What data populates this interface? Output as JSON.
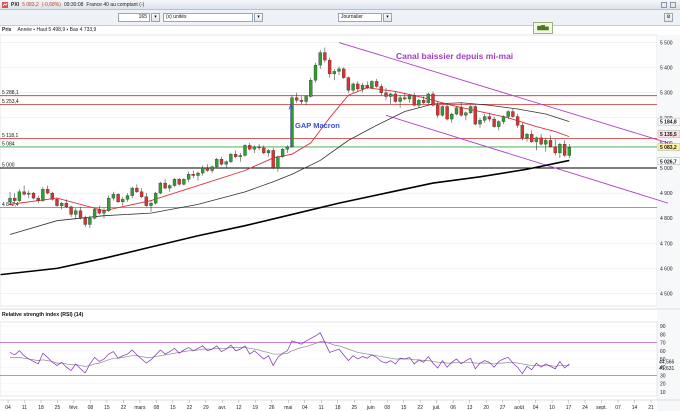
{
  "window": {
    "symbol": "PXI",
    "price": "5 083,2",
    "change": "(-0,68%)",
    "time": "09:30:08",
    "instrument": "France 40 au comptant (-)"
  },
  "toolbar": {
    "count_value": "165",
    "units_label": "(x) unités",
    "period_label": "Journalier"
  },
  "chart_head": {
    "symbol": "Prix",
    "info": "Année ▪ Haut 5 498,9 ▪ Bas 4 733,9"
  },
  "chart_data": {
    "type": "line",
    "subtype": "candlestick",
    "annotations": {
      "channel_title": "Canal baissier depuis mi-mai",
      "gap_label": "GAP Macron"
    },
    "price_axis": {
      "ticks": [
        5500,
        5400,
        5300,
        5200,
        5100,
        5000,
        4900,
        4800,
        4700,
        4600,
        4500
      ],
      "tick_labels": [
        "5 500",
        "5 400",
        "5 300",
        "5 200",
        "5 100",
        "5 000",
        "4 900",
        "4 800",
        "4 700",
        "4 600",
        "4 500"
      ],
      "ylim": [
        4450,
        5530
      ],
      "right_tags": [
        {
          "value": 5184.8,
          "label": "5 184,8",
          "color": "#ffffff"
        },
        {
          "value": 5135.5,
          "label": "5 135,5",
          "color": "#fde2e2"
        },
        {
          "value": 5083.2,
          "label": "5 083,2",
          "color": "#fff3a8"
        },
        {
          "value": 5026.7,
          "label": "5 026,7",
          "color": "#ffffff"
        }
      ]
    },
    "horizontal_levels": [
      {
        "value": 5288.1,
        "label": "5 288,1",
        "color": "#d42a2a"
      },
      {
        "value": 5253.4,
        "label": "5 253,4",
        "color": "#d42a2a"
      },
      {
        "value": 5118.1,
        "label": "5 118,1",
        "color": "#d42a2a"
      },
      {
        "value": 5084,
        "label": "5 084",
        "color": "#3aa63a"
      },
      {
        "value": 5000,
        "label": "5 000",
        "color": "#000000"
      },
      {
        "value": 4842.4,
        "label": "4 842,4",
        "color": "#3aa63a"
      }
    ],
    "x_axis": {
      "tick_labels": [
        "04",
        "11",
        "18",
        "25",
        "févr.",
        "08",
        "15",
        "22",
        "mars",
        "08",
        "15",
        "22",
        "29",
        "avr.",
        "12",
        "19",
        "26",
        "mai",
        "04",
        "11",
        "18",
        "25",
        "juin",
        "08",
        "15",
        "22",
        "juil.",
        "06",
        "13",
        "20",
        "27",
        "août",
        "04",
        "10",
        "17",
        "24",
        "sept.",
        "07",
        "14",
        "21"
      ]
    },
    "candles_ohlc": [
      [
        4865,
        4905,
        4855,
        4880
      ],
      [
        4880,
        4900,
        4860,
        4870
      ],
      [
        4870,
        4915,
        4865,
        4905
      ],
      [
        4905,
        4930,
        4890,
        4895
      ],
      [
        4895,
        4910,
        4880,
        4900
      ],
      [
        4900,
        4905,
        4875,
        4880
      ],
      [
        4880,
        4890,
        4860,
        4870
      ],
      [
        4870,
        4925,
        4865,
        4915
      ],
      [
        4915,
        4930,
        4895,
        4900
      ],
      [
        4900,
        4905,
        4870,
        4875
      ],
      [
        4875,
        4880,
        4845,
        4850
      ],
      [
        4850,
        4865,
        4835,
        4860
      ],
      [
        4860,
        4875,
        4840,
        4845
      ],
      [
        4845,
        4850,
        4805,
        4815
      ],
      [
        4815,
        4840,
        4795,
        4830
      ],
      [
        4830,
        4845,
        4795,
        4800
      ],
      [
        4800,
        4810,
        4765,
        4775
      ],
      [
        4775,
        4810,
        4760,
        4800
      ],
      [
        4800,
        4840,
        4795,
        4835
      ],
      [
        4835,
        4850,
        4815,
        4820
      ],
      [
        4820,
        4840,
        4800,
        4830
      ],
      [
        4830,
        4890,
        4825,
        4880
      ],
      [
        4880,
        4905,
        4870,
        4895
      ],
      [
        4895,
        4900,
        4860,
        4865
      ],
      [
        4865,
        4885,
        4850,
        4875
      ],
      [
        4875,
        4900,
        4865,
        4890
      ],
      [
        4890,
        4925,
        4880,
        4920
      ],
      [
        4920,
        4935,
        4900,
        4905
      ],
      [
        4905,
        4920,
        4880,
        4885
      ],
      [
        4885,
        4900,
        4845,
        4850
      ],
      [
        4850,
        4870,
        4825,
        4860
      ],
      [
        4860,
        4905,
        4855,
        4900
      ],
      [
        4900,
        4945,
        4895,
        4940
      ],
      [
        4940,
        4955,
        4915,
        4920
      ],
      [
        4920,
        4935,
        4905,
        4930
      ],
      [
        4930,
        4960,
        4925,
        4955
      ],
      [
        4955,
        4960,
        4930,
        4935
      ],
      [
        4935,
        4960,
        4930,
        4955
      ],
      [
        4955,
        4985,
        4945,
        4975
      ],
      [
        4975,
        4990,
        4960,
        4970
      ],
      [
        4970,
        4985,
        4950,
        4980
      ],
      [
        4980,
        5010,
        4970,
        5000
      ],
      [
        5000,
        5015,
        4985,
        4990
      ],
      [
        4990,
        5010,
        4980,
        5005
      ],
      [
        5005,
        5040,
        5000,
        5035
      ],
      [
        5035,
        5045,
        5010,
        5015
      ],
      [
        5015,
        5030,
        5000,
        5025
      ],
      [
        5025,
        5060,
        5020,
        5055
      ],
      [
        5055,
        5070,
        5040,
        5045
      ],
      [
        5045,
        5060,
        5025,
        5050
      ],
      [
        5050,
        5095,
        5045,
        5090
      ],
      [
        5090,
        5100,
        5070,
        5075
      ],
      [
        5075,
        5090,
        5060,
        5085
      ],
      [
        5085,
        5095,
        5070,
        5080
      ],
      [
        5080,
        5090,
        5055,
        5060
      ],
      [
        5060,
        5075,
        5045,
        5070
      ],
      [
        5070,
        5080,
        4995,
        5000
      ],
      [
        5000,
        5050,
        4985,
        5045
      ],
      [
        5045,
        5080,
        5040,
        5075
      ],
      [
        5075,
        5090,
        5060,
        5085
      ],
      [
        5085,
        5290,
        5085,
        5280
      ],
      [
        5280,
        5300,
        5260,
        5270
      ],
      [
        5270,
        5285,
        5255,
        5265
      ],
      [
        5265,
        5290,
        5250,
        5285
      ],
      [
        5285,
        5360,
        5280,
        5350
      ],
      [
        5350,
        5420,
        5340,
        5410
      ],
      [
        5410,
        5470,
        5395,
        5460
      ],
      [
        5460,
        5480,
        5420,
        5430
      ],
      [
        5430,
        5440,
        5360,
        5375
      ],
      [
        5375,
        5395,
        5350,
        5385
      ],
      [
        5385,
        5405,
        5370,
        5395
      ],
      [
        5395,
        5400,
        5355,
        5360
      ],
      [
        5360,
        5365,
        5300,
        5310
      ],
      [
        5310,
        5340,
        5300,
        5335
      ],
      [
        5335,
        5345,
        5305,
        5315
      ],
      [
        5315,
        5340,
        5300,
        5330
      ],
      [
        5330,
        5345,
        5315,
        5320
      ],
      [
        5320,
        5350,
        5315,
        5345
      ],
      [
        5345,
        5355,
        5320,
        5325
      ],
      [
        5325,
        5335,
        5290,
        5300
      ],
      [
        5300,
        5320,
        5270,
        5285
      ],
      [
        5285,
        5300,
        5255,
        5295
      ],
      [
        5295,
        5305,
        5260,
        5265
      ],
      [
        5265,
        5290,
        5240,
        5280
      ],
      [
        5280,
        5300,
        5270,
        5275
      ],
      [
        5275,
        5295,
        5260,
        5290
      ],
      [
        5290,
        5300,
        5245,
        5250
      ],
      [
        5250,
        5275,
        5240,
        5270
      ],
      [
        5270,
        5285,
        5255,
        5260
      ],
      [
        5260,
        5300,
        5255,
        5295
      ],
      [
        5295,
        5305,
        5245,
        5250
      ],
      [
        5250,
        5265,
        5200,
        5210
      ],
      [
        5210,
        5250,
        5205,
        5245
      ],
      [
        5245,
        5255,
        5190,
        5195
      ],
      [
        5195,
        5220,
        5180,
        5215
      ],
      [
        5215,
        5245,
        5210,
        5240
      ],
      [
        5240,
        5260,
        5205,
        5210
      ],
      [
        5210,
        5225,
        5190,
        5220
      ],
      [
        5220,
        5250,
        5215,
        5245
      ],
      [
        5245,
        5250,
        5170,
        5175
      ],
      [
        5175,
        5200,
        5160,
        5190
      ],
      [
        5190,
        5215,
        5180,
        5205
      ],
      [
        5205,
        5220,
        5185,
        5195
      ],
      [
        5195,
        5205,
        5160,
        5165
      ],
      [
        5165,
        5190,
        5150,
        5185
      ],
      [
        5185,
        5210,
        5175,
        5205
      ],
      [
        5205,
        5230,
        5195,
        5225
      ],
      [
        5225,
        5235,
        5200,
        5205
      ],
      [
        5205,
        5215,
        5160,
        5170
      ],
      [
        5170,
        5180,
        5110,
        5120
      ],
      [
        5120,
        5140,
        5105,
        5135
      ],
      [
        5135,
        5150,
        5100,
        5105
      ],
      [
        5105,
        5125,
        5070,
        5120
      ],
      [
        5120,
        5135,
        5090,
        5095
      ],
      [
        5095,
        5120,
        5065,
        5110
      ],
      [
        5110,
        5130,
        5080,
        5085
      ],
      [
        5085,
        5115,
        5050,
        5060
      ],
      [
        5060,
        5100,
        5040,
        5095
      ],
      [
        5095,
        5110,
        5045,
        5050
      ],
      [
        5050,
        5095,
        5040,
        5083
      ]
    ],
    "sma_short": [
      [
        0,
        4855
      ],
      [
        10,
        4880
      ],
      [
        20,
        4830
      ],
      [
        30,
        4870
      ],
      [
        40,
        4930
      ],
      [
        50,
        4990
      ],
      [
        56,
        5040
      ],
      [
        60,
        5055
      ],
      [
        64,
        5100
      ],
      [
        68,
        5200
      ],
      [
        72,
        5290
      ],
      [
        76,
        5320
      ],
      [
        82,
        5305
      ],
      [
        88,
        5280
      ],
      [
        94,
        5250
      ],
      [
        100,
        5225
      ],
      [
        106,
        5200
      ],
      [
        112,
        5165
      ],
      [
        116,
        5145
      ],
      [
        119,
        5125
      ]
    ],
    "sma_long": [
      [
        0,
        4735
      ],
      [
        10,
        4790
      ],
      [
        20,
        4810
      ],
      [
        30,
        4820
      ],
      [
        40,
        4855
      ],
      [
        50,
        4905
      ],
      [
        56,
        4945
      ],
      [
        60,
        4975
      ],
      [
        66,
        5030
      ],
      [
        72,
        5110
      ],
      [
        78,
        5170
      ],
      [
        84,
        5225
      ],
      [
        90,
        5255
      ],
      [
        96,
        5260
      ],
      [
        102,
        5250
      ],
      [
        108,
        5235
      ],
      [
        114,
        5215
      ],
      [
        119,
        5185
      ]
    ],
    "sma_200": [
      [
        -2,
        4575
      ],
      [
        10,
        4600
      ],
      [
        20,
        4640
      ],
      [
        30,
        4685
      ],
      [
        40,
        4730
      ],
      [
        50,
        4770
      ],
      [
        60,
        4815
      ],
      [
        70,
        4860
      ],
      [
        80,
        4900
      ],
      [
        90,
        4940
      ],
      [
        100,
        4965
      ],
      [
        110,
        4995
      ],
      [
        119,
        5030
      ]
    ],
    "channel": {
      "upper": [
        [
          70,
          5500
        ],
        [
          140,
          5100
        ]
      ],
      "lower": [
        [
          80,
          5210
        ],
        [
          140,
          4860
        ]
      ]
    },
    "rsi": {
      "label": "Relative strength index (RSI) (14)",
      "ticks": [
        90,
        80,
        70,
        60,
        50,
        40,
        30,
        20,
        10
      ],
      "ylim": [
        5,
        95
      ],
      "right_tags": [
        {
          "value": 44.566,
          "label": "44,566"
        },
        {
          "value": 41.631,
          "label": "41,631"
        }
      ],
      "levels": [
        70,
        30
      ],
      "values": [
        58,
        55,
        60,
        54,
        50,
        47,
        44,
        57,
        52,
        46,
        42,
        46,
        40,
        36,
        44,
        38,
        33,
        44,
        52,
        47,
        50,
        56,
        59,
        51,
        54,
        56,
        61,
        55,
        50,
        45,
        49,
        55,
        61,
        56,
        59,
        63,
        57,
        61,
        64,
        60,
        63,
        66,
        60,
        62,
        66,
        59,
        62,
        67,
        60,
        62,
        66,
        56,
        60,
        55,
        50,
        54,
        42,
        52,
        57,
        60,
        72,
        70,
        68,
        72,
        75,
        78,
        82,
        70,
        58,
        60,
        62,
        55,
        48,
        54,
        50,
        53,
        51,
        55,
        52,
        47,
        45,
        48,
        44,
        51,
        50,
        52,
        44,
        49,
        46,
        53,
        45,
        39,
        48,
        40,
        46,
        50,
        44,
        48,
        51,
        38,
        45,
        48,
        46,
        40,
        47,
        50,
        52,
        45,
        40,
        32,
        41,
        37,
        45,
        40,
        44,
        41,
        38,
        47,
        39,
        44
      ],
      "signal": [
        52,
        52,
        52,
        51,
        50,
        49,
        48,
        49,
        48,
        47,
        45,
        45,
        44,
        43,
        43,
        42,
        41,
        42,
        44,
        45,
        47,
        49,
        51,
        51,
        52,
        53,
        54,
        54,
        53,
        52,
        52,
        53,
        54,
        55,
        56,
        57,
        58,
        59,
        60,
        60,
        61,
        62,
        62,
        62,
        63,
        63,
        63,
        64,
        64,
        64,
        64,
        63,
        62,
        61,
        59,
        58,
        56,
        56,
        56,
        57,
        60,
        62,
        64,
        65,
        67,
        69,
        71,
        71,
        69,
        67,
        66,
        64,
        62,
        60,
        58,
        57,
        56,
        55,
        54,
        53,
        52,
        51,
        50,
        50,
        50,
        50,
        49,
        49,
        48,
        48,
        47,
        46,
        46,
        45,
        45,
        46,
        46,
        46,
        46,
        45,
        45,
        45,
        45,
        44,
        45,
        45,
        46,
        46,
        45,
        44,
        43,
        42,
        42,
        42,
        42,
        42,
        41,
        42,
        42,
        42
      ]
    }
  }
}
